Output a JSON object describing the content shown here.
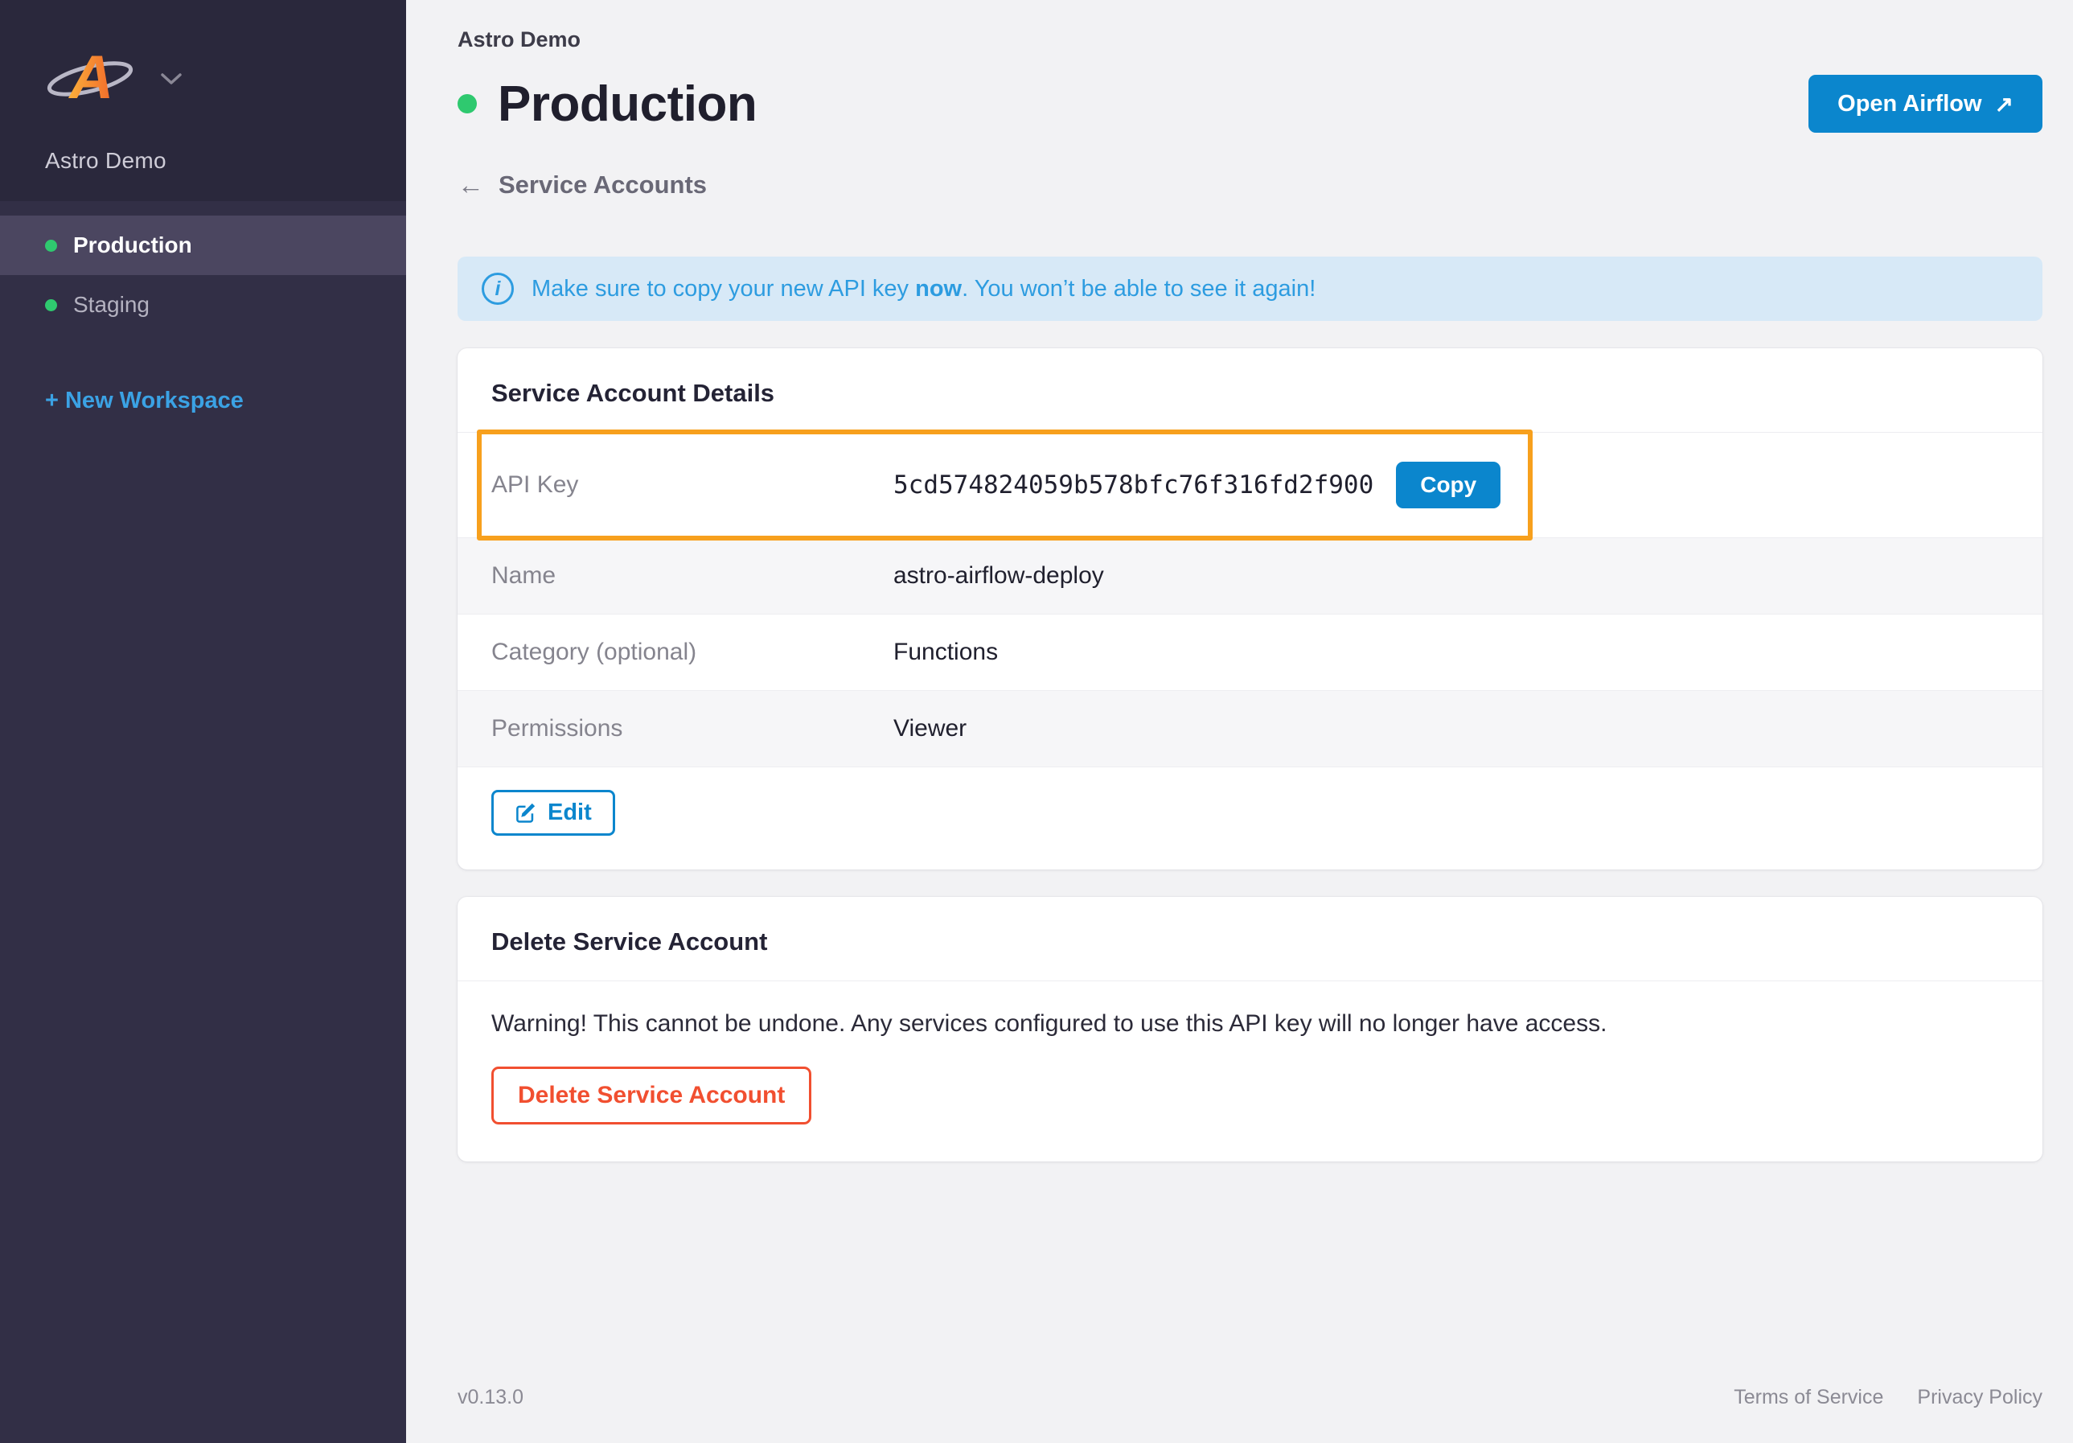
{
  "colors": {
    "primary_blue": "#0b86cd",
    "link_blue": "#3ba2e4",
    "alert_blue": "#2d9ce0",
    "alert_bg": "#d7e9f7",
    "success_green": "#2fc96f",
    "danger_red": "#f14f30",
    "annotation_orange": "#f7a01d",
    "sidebar_bg": "#322f46"
  },
  "sidebar": {
    "workspace_name": "Astro Demo",
    "items": [
      {
        "label": "Production",
        "active": true
      },
      {
        "label": "Staging",
        "active": false
      }
    ],
    "new_workspace_label": "+ New Workspace"
  },
  "header": {
    "breadcrumb": "Astro Demo",
    "title": "Production",
    "open_airflow_label": "Open Airflow"
  },
  "subheader": {
    "back_label": "Service Accounts"
  },
  "alert": {
    "text_before": "Make sure to copy your new API key ",
    "text_bold": "now",
    "text_after": ". You won’t be able to see it again!"
  },
  "details_card": {
    "title": "Service Account Details",
    "rows": [
      {
        "label": "API Key",
        "value": "5cd574824059b578bfc76f316fd2f900"
      },
      {
        "label": "Name",
        "value": "astro-airflow-deploy"
      },
      {
        "label": "Category (optional)",
        "value": "Functions"
      },
      {
        "label": "Permissions",
        "value": "Viewer"
      }
    ],
    "copy_label": "Copy",
    "edit_label": "Edit"
  },
  "delete_card": {
    "title": "Delete Service Account",
    "warning": "Warning! This cannot be undone. Any services configured to use this API key will no longer have access.",
    "button_label": "Delete Service Account"
  },
  "footer": {
    "version": "v0.13.0",
    "links": [
      "Terms of Service",
      "Privacy Policy"
    ]
  },
  "icons": {
    "external_arrow": "↗",
    "back_arrow": "←",
    "info": "i",
    "logo_letter": "A"
  }
}
